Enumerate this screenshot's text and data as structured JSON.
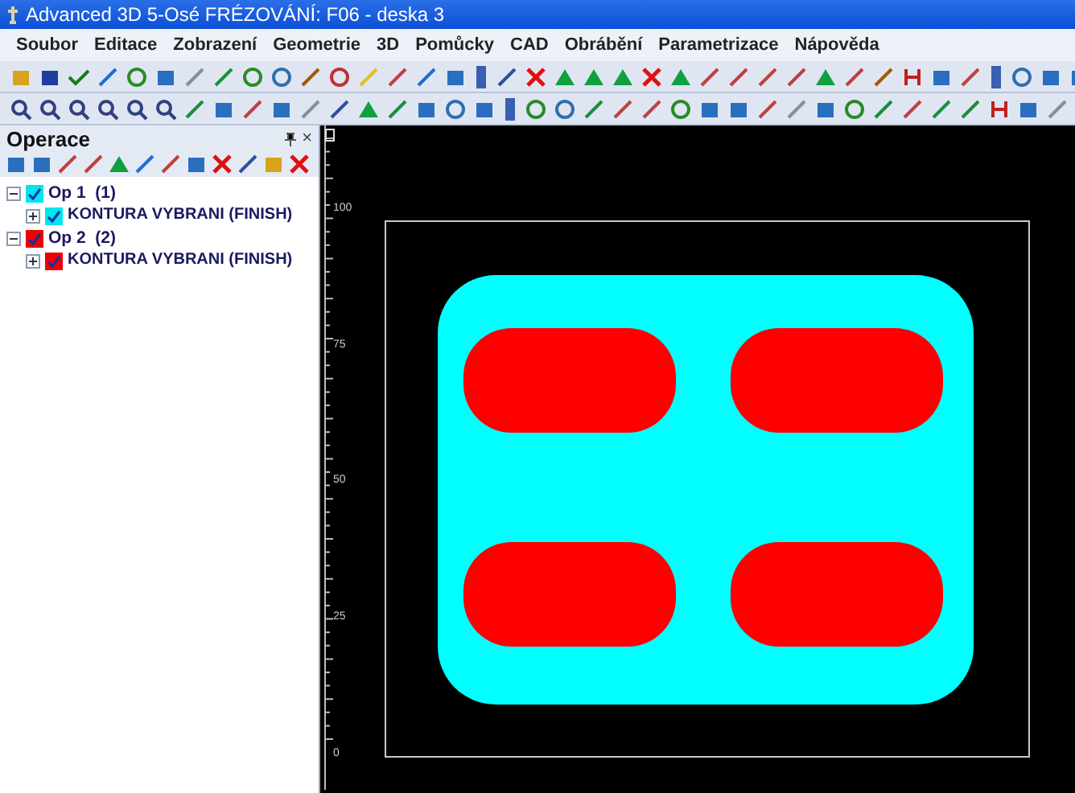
{
  "window": {
    "title": "Advanced 3D 5-Osé FRÉZOVÁNÍ: F06 - deska 3"
  },
  "menu": [
    "Soubor",
    "Editace",
    "Zobrazení",
    "Geometrie",
    "3D",
    "Pomůcky",
    "CAD",
    "Obrábění",
    "Parametrizace",
    "Nápověda"
  ],
  "panel": {
    "title": "Operace",
    "close": "×",
    "tree": [
      {
        "label": "Op 1  (1)",
        "color": "#00e5ee",
        "checked": true,
        "expanded": true,
        "children": [
          {
            "label": "KONTURA VYBRANI (FINISH)",
            "color": "#00e5ee",
            "checked": true,
            "expanded": false
          }
        ]
      },
      {
        "label": "Op 2  (2)",
        "color": "#ee0000",
        "checked": true,
        "expanded": true,
        "children": [
          {
            "label": "KONTURA VYBRANI (FINISH)",
            "color": "#ee0000",
            "checked": true,
            "expanded": false
          }
        ]
      }
    ]
  },
  "ruler": {
    "labels": [
      "100",
      "75",
      "50",
      "25",
      "0"
    ]
  }
}
